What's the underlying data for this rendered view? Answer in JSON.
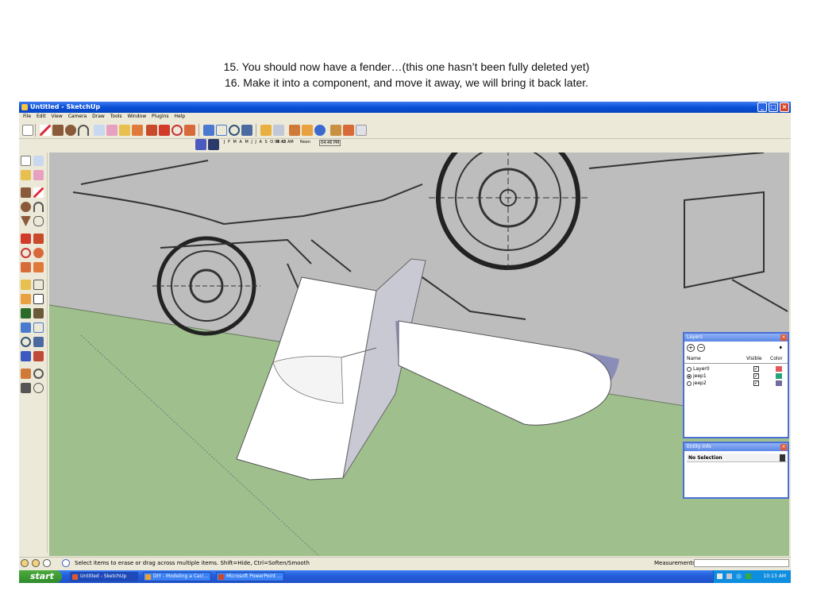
{
  "slide": {
    "caption_line1": "15. You should now have a fender…(this one hasn’t been fully deleted yet)",
    "caption_line2": "16. Make it into a component, and move it away, we will bring it back later."
  },
  "window": {
    "title": "Untitled - SketchUp",
    "menu": [
      "File",
      "Edit",
      "View",
      "Camera",
      "Draw",
      "Tools",
      "Window",
      "Plugins",
      "Help"
    ]
  },
  "shadow_toolbar": {
    "months": "J F M A M J J A S O N D",
    "time_start": "08:43 AM",
    "time_noon": "Noon",
    "time_end": "04:46 PM"
  },
  "status": {
    "hint": "Select items to erase or drag across multiple items. Shift=Hide, Ctrl=Soften/Smooth",
    "measurements_label": "Measurements"
  },
  "layers_panel": {
    "title": "Layers",
    "col_name": "Name",
    "col_visible": "Visible",
    "col_color": "Color",
    "layers": [
      {
        "name": "Layer0",
        "active": false,
        "visible": true,
        "color": "#e05a5a"
      },
      {
        "name": "jeep1",
        "active": true,
        "visible": true,
        "color": "#2aa37a"
      },
      {
        "name": "jeep2",
        "active": false,
        "visible": true,
        "color": "#6e6e9e"
      }
    ]
  },
  "entity_panel": {
    "title": "Entity Info",
    "selection": "No Selection"
  },
  "taskbar": {
    "start_label": "start",
    "tasks": [
      {
        "label": "Untitled - SketchUp",
        "icon_color": "#e2572b"
      },
      {
        "label": "DIY - Modeling a Car/...",
        "icon_color": "#f0a030"
      },
      {
        "label": "Microsoft PowerPoint ...",
        "icon_color": "#d24726"
      }
    ],
    "clock": "10:13 AM"
  }
}
